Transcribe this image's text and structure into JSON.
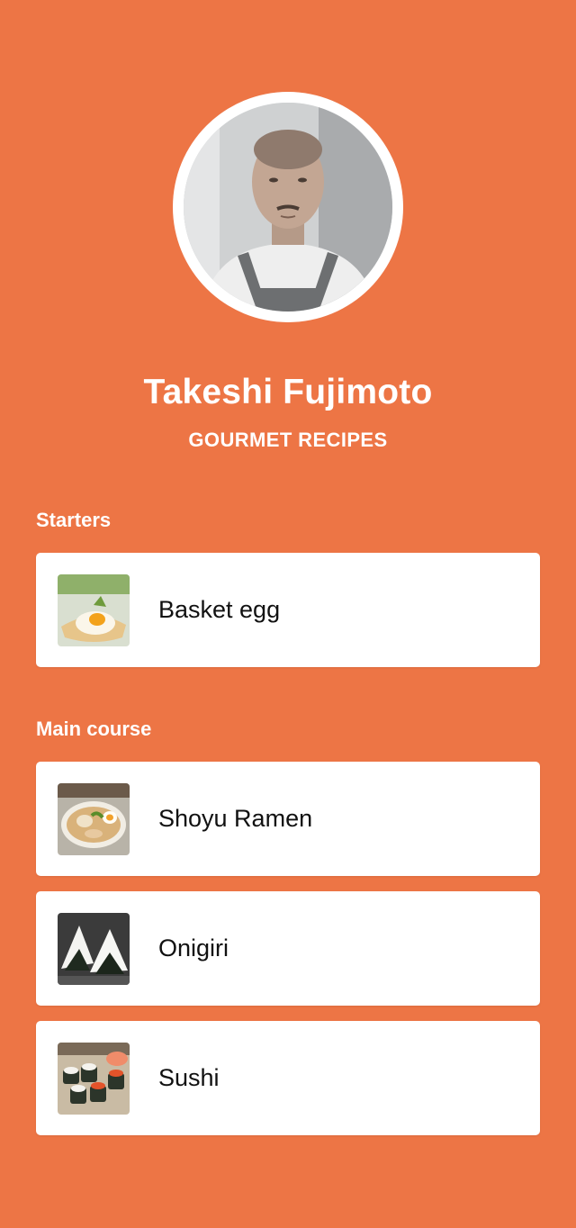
{
  "profile": {
    "name": "Takeshi Fujimoto",
    "subtitle": "GOURMET RECIPES"
  },
  "sections": [
    {
      "title": "Starters",
      "items": [
        {
          "label": "Basket egg",
          "image": "basket-egg-photo"
        }
      ]
    },
    {
      "title": "Main course",
      "items": [
        {
          "label": "Shoyu Ramen",
          "image": "shoyu-ramen-photo"
        },
        {
          "label": "Onigiri",
          "image": "onigiri-photo"
        },
        {
          "label": "Sushi",
          "image": "sushi-photo"
        }
      ]
    }
  ],
  "colors": {
    "background": "#ed7545",
    "card": "#ffffff",
    "text_light": "#ffffff",
    "text_dark": "#111111"
  }
}
